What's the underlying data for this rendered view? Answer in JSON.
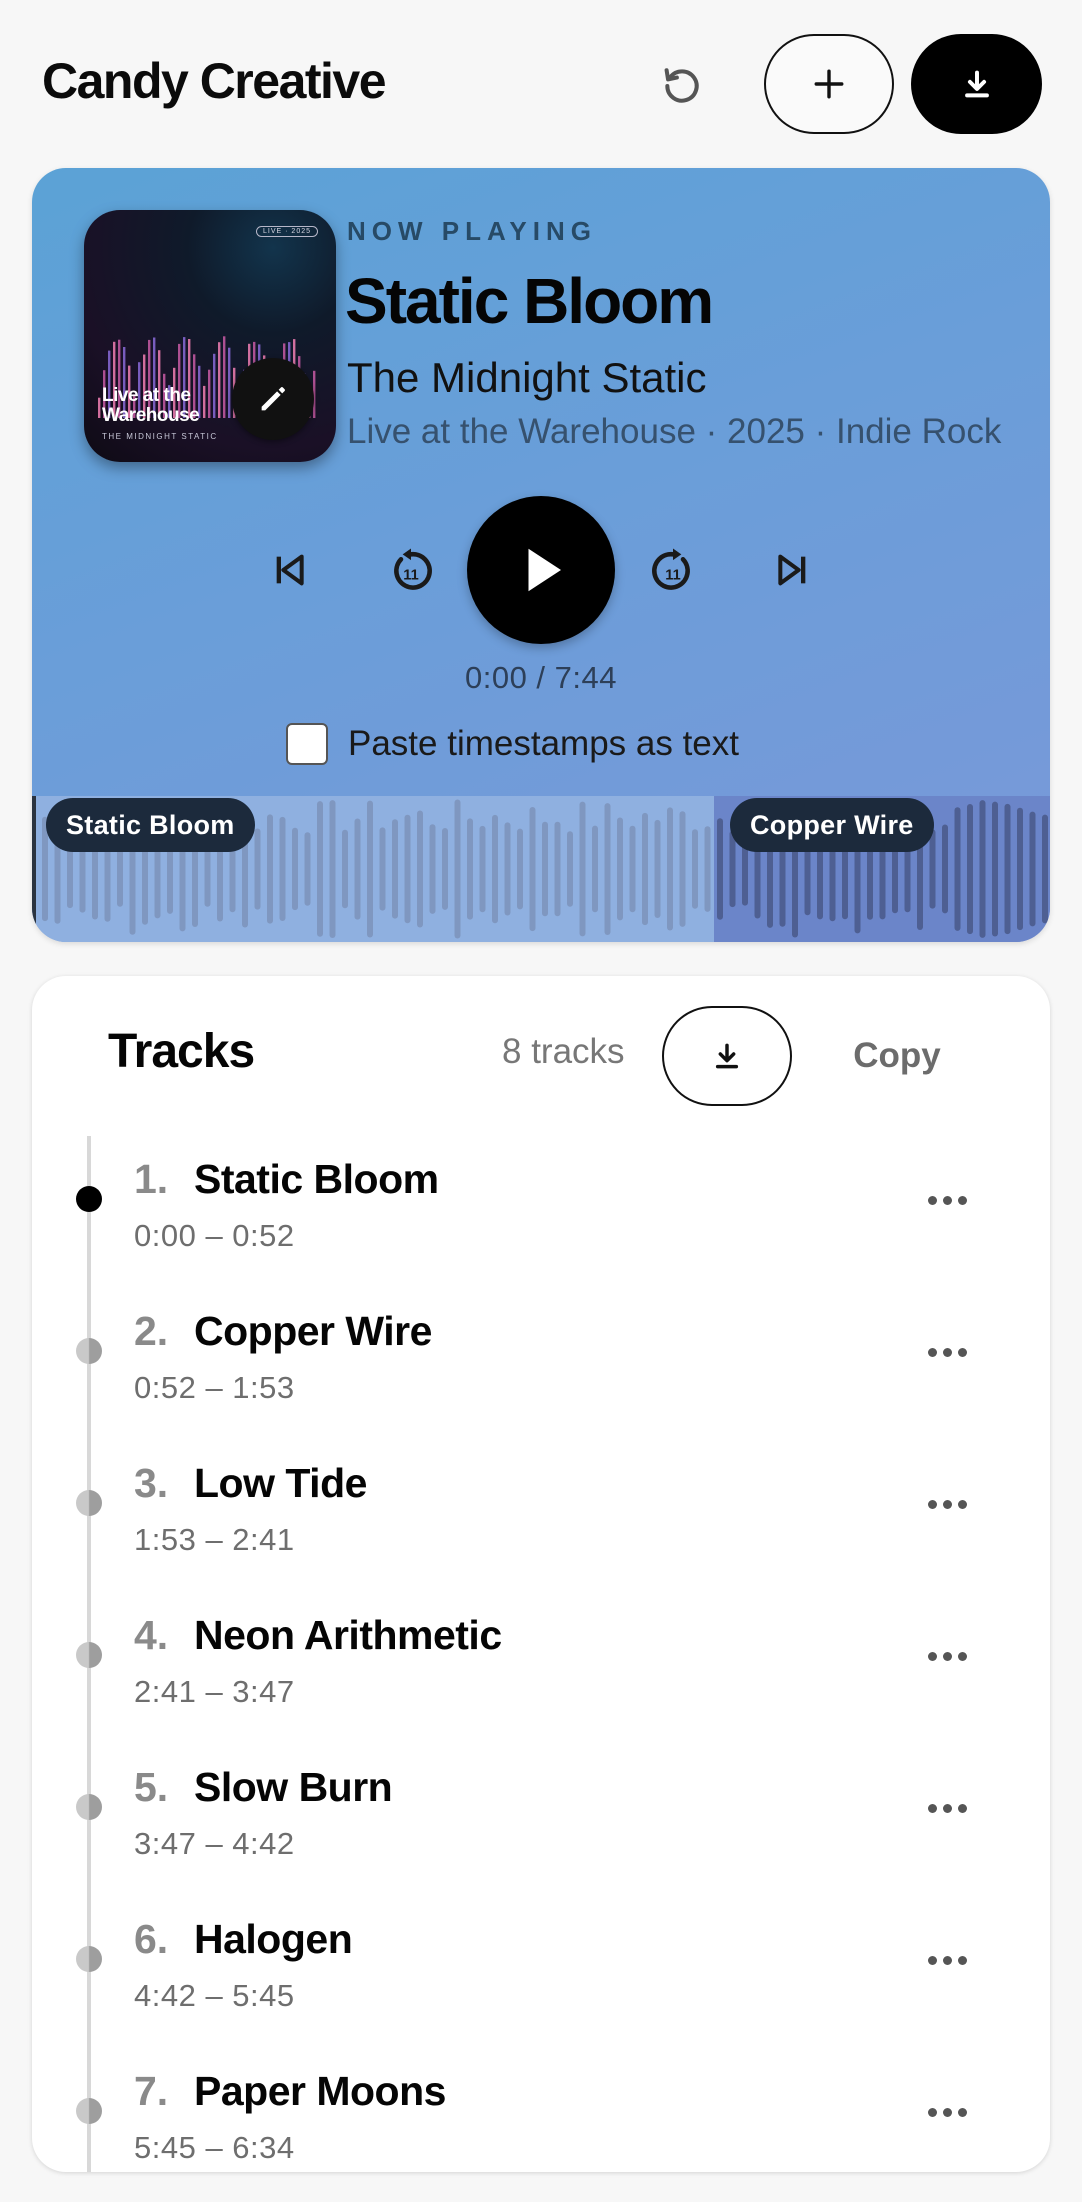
{
  "header": {
    "brand": "Candy Creative",
    "icons": {
      "reset": "reset-icon",
      "add": "plus-icon",
      "download": "download-icon"
    }
  },
  "player": {
    "now_playing_label": "NOW PLAYING",
    "title": "Static Bloom",
    "artist": "The Midnight Static",
    "meta": "Live at the Warehouse · 2025 · Indie Rock",
    "cover": {
      "badge": "LIVE · 2025",
      "title": "Live at the Warehouse",
      "subtitle": "THE MIDNIGHT STATIC"
    },
    "time": "0:00 / 7:44",
    "paste_timestamps_label": "Paste timestamps as text",
    "paste_timestamps_checked": false,
    "waveform_segments": [
      "Static Bloom",
      "Copper Wire"
    ],
    "accent_colors": {
      "gradient_start": "#5ba2d6",
      "gradient_end": "#7a98d9",
      "chip": "#1c2a3c"
    }
  },
  "tracks": {
    "title": "Tracks",
    "count_label": "8 tracks",
    "copy_label": "Copy",
    "items": [
      {
        "num": "1.",
        "name": "Static Bloom",
        "range": "0:00 – 0:52",
        "active": true
      },
      {
        "num": "2.",
        "name": "Copper Wire",
        "range": "0:52 – 1:53",
        "active": false
      },
      {
        "num": "3.",
        "name": "Low Tide",
        "range": "1:53 – 2:41",
        "active": false
      },
      {
        "num": "4.",
        "name": "Neon Arithmetic",
        "range": "2:41 – 3:47",
        "active": false
      },
      {
        "num": "5.",
        "name": "Slow Burn",
        "range": "3:47 – 4:42",
        "active": false
      },
      {
        "num": "6.",
        "name": "Halogen",
        "range": "4:42 – 5:45",
        "active": false
      },
      {
        "num": "7.",
        "name": "Paper Moons",
        "range": "5:45 – 6:34",
        "active": false
      }
    ]
  }
}
